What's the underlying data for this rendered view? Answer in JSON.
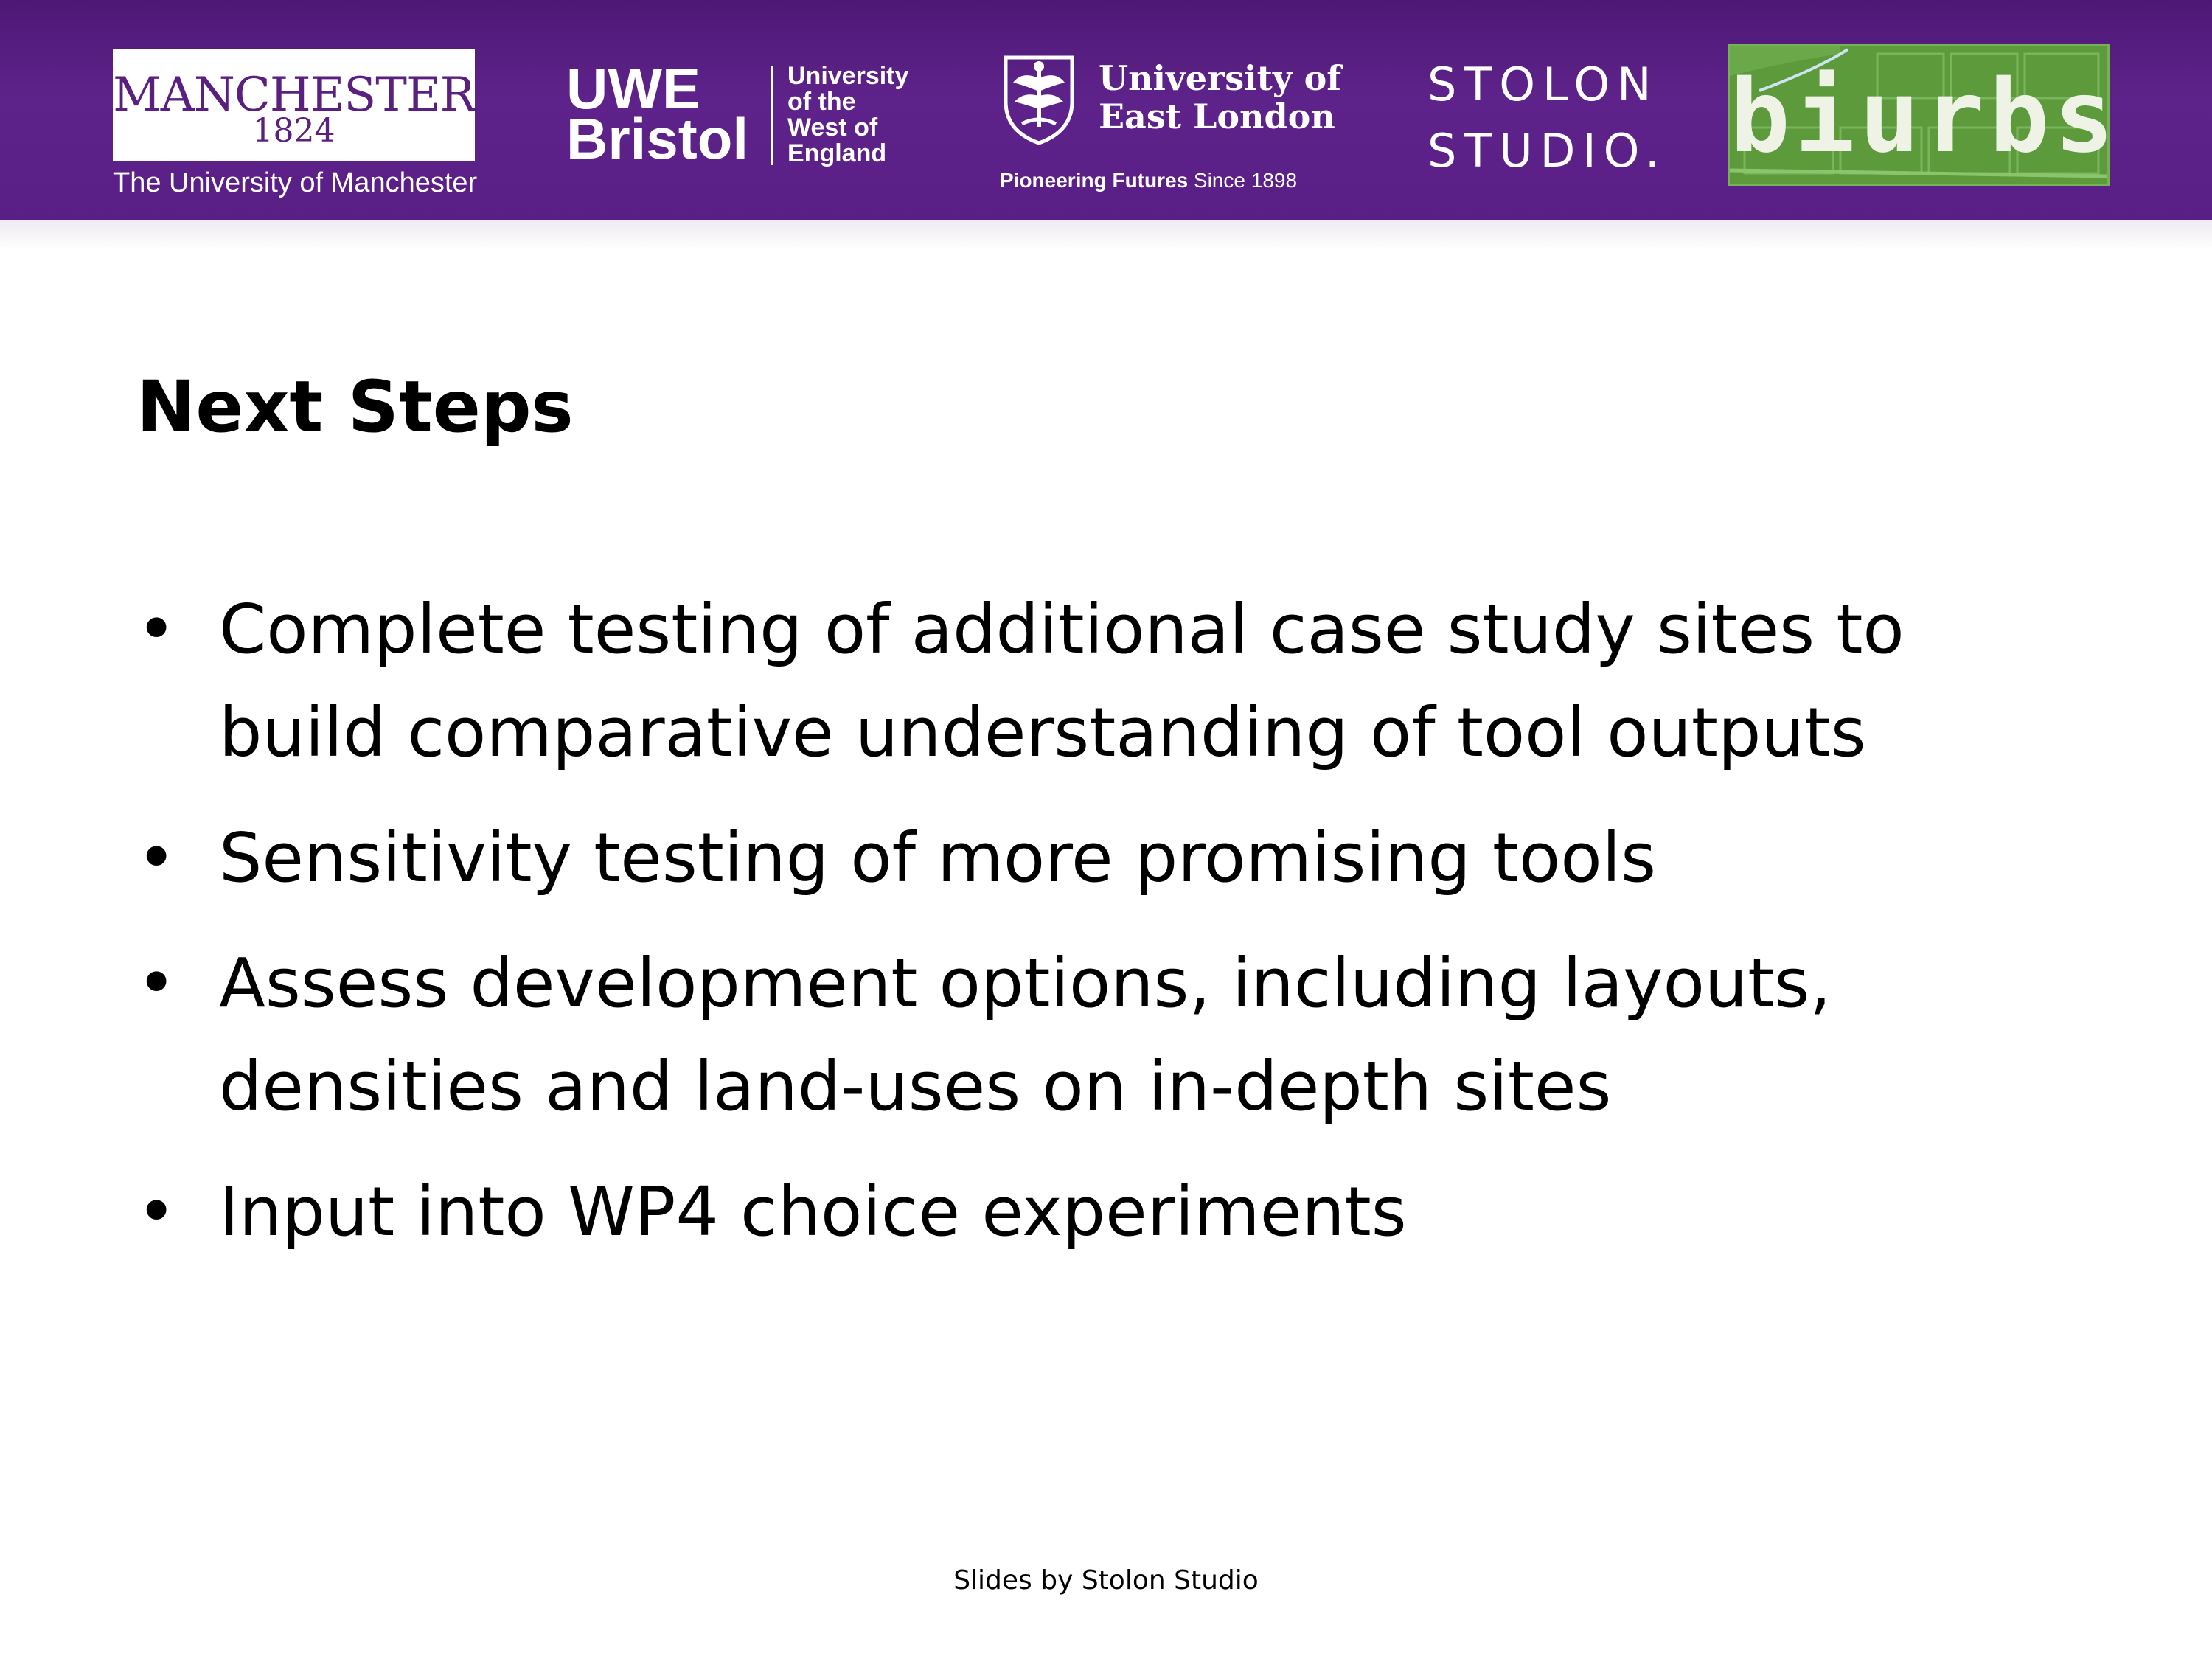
{
  "header": {
    "logos": {
      "manchester": {
        "wordmark": "MANCHESTER",
        "year": "1824",
        "subtitle": "The University of Manchester"
      },
      "uwe": {
        "line1": "UWE",
        "line2": "Bristol",
        "side_lines": [
          "University",
          "of the",
          "West of",
          "England"
        ]
      },
      "uel": {
        "name_line1": "University of",
        "name_line2": "East London",
        "tagline_bold": "Pioneering Futures",
        "tagline_rest": " Since 1898"
      },
      "stolon": {
        "line1": "STOLON",
        "line2": "STUDIO."
      },
      "biurbs": {
        "wordmark": "biurbs"
      }
    },
    "banner_color": "#5a1f86"
  },
  "slide": {
    "title": "Next Steps",
    "bullets": [
      "Complete testing of additional case study sites to build comparative understanding of tool outputs",
      "Sensitivity testing of more promising tools",
      "Assess development options, including layouts, densities and land-uses on in-depth sites",
      "Input into WP4 choice experiments"
    ],
    "bullet_glyph": "•"
  },
  "footer": {
    "credit": "Slides by Stolon Studio"
  }
}
